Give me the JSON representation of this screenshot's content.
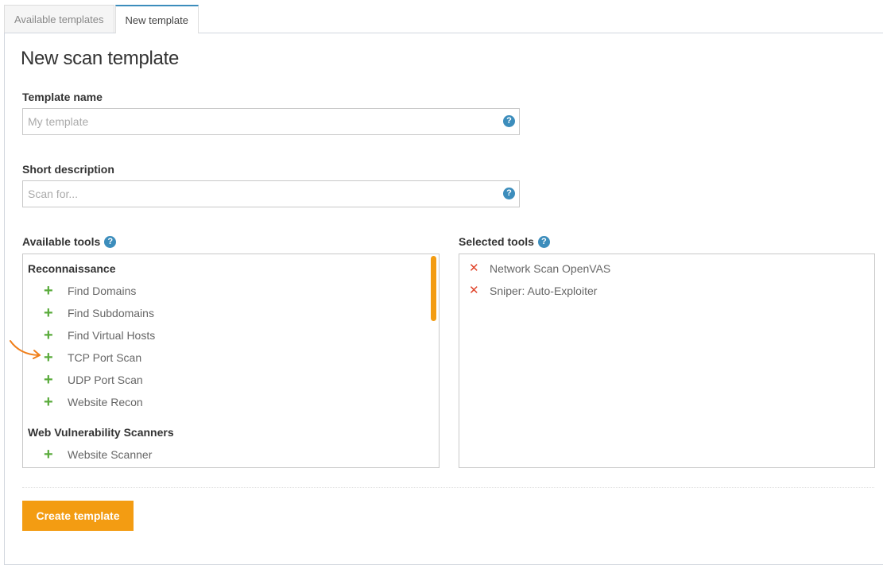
{
  "tabs": [
    {
      "label": "Available templates",
      "active": false
    },
    {
      "label": "New template",
      "active": true
    }
  ],
  "page_title": "New scan template",
  "template_name": {
    "label": "Template name",
    "value": "",
    "placeholder": "My template",
    "help_icon": "question-circle-icon"
  },
  "short_description": {
    "label": "Short description",
    "value": "",
    "placeholder": "Scan for...",
    "help_icon": "question-circle-icon"
  },
  "available_tools": {
    "label": "Available tools",
    "groups": [
      {
        "title": "Reconnaissance",
        "items": [
          "Find Domains",
          "Find Subdomains",
          "Find Virtual Hosts",
          "TCP Port Scan",
          "UDP Port Scan",
          "Website Recon"
        ]
      },
      {
        "title": "Web Vulnerability Scanners",
        "items": [
          "Website Scanner"
        ]
      }
    ],
    "add_icon": "plus-icon"
  },
  "selected_tools": {
    "label": "Selected tools",
    "items": [
      "Network Scan OpenVAS",
      "Sniper: Auto-Exploiter"
    ],
    "remove_icon": "x-icon"
  },
  "create_button": "Create template",
  "help_glyph": "?",
  "add_glyph": "+",
  "remove_glyph": "✕",
  "colors": {
    "accent_orange": "#f39c12",
    "help_blue": "#3c8dbc",
    "add_green": "#5aab3c",
    "remove_red": "#e0452b"
  }
}
